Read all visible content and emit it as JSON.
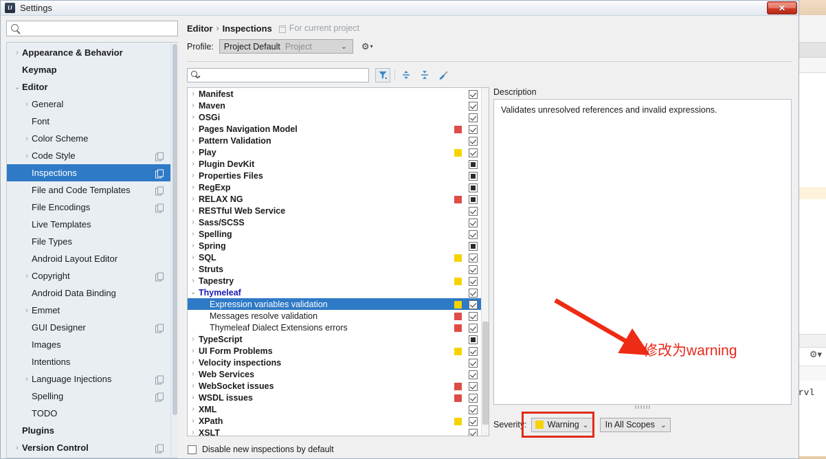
{
  "window": {
    "title": "Settings",
    "icon": "intellij-logo-icon",
    "close_label": "✕"
  },
  "sidebar": {
    "search_placeholder": "",
    "search_value": "",
    "items": [
      {
        "label": "Appearance & Behavior",
        "arrow": "›",
        "bold": true,
        "indent": 0,
        "copy": false,
        "selected": false
      },
      {
        "label": "Keymap",
        "arrow": "",
        "bold": true,
        "indent": 0,
        "copy": false,
        "selected": false
      },
      {
        "label": "Editor",
        "arrow": "⌄",
        "bold": true,
        "indent": 0,
        "copy": false,
        "selected": false
      },
      {
        "label": "General",
        "arrow": "›",
        "bold": false,
        "indent": 1,
        "copy": false,
        "selected": false
      },
      {
        "label": "Font",
        "arrow": "",
        "bold": false,
        "indent": 1,
        "copy": false,
        "selected": false
      },
      {
        "label": "Color Scheme",
        "arrow": "›",
        "bold": false,
        "indent": 1,
        "copy": false,
        "selected": false
      },
      {
        "label": "Code Style",
        "arrow": "›",
        "bold": false,
        "indent": 1,
        "copy": true,
        "selected": false
      },
      {
        "label": "Inspections",
        "arrow": "",
        "bold": false,
        "indent": 1,
        "copy": true,
        "selected": true
      },
      {
        "label": "File and Code Templates",
        "arrow": "",
        "bold": false,
        "indent": 1,
        "copy": true,
        "selected": false
      },
      {
        "label": "File Encodings",
        "arrow": "",
        "bold": false,
        "indent": 1,
        "copy": true,
        "selected": false
      },
      {
        "label": "Live Templates",
        "arrow": "",
        "bold": false,
        "indent": 1,
        "copy": false,
        "selected": false
      },
      {
        "label": "File Types",
        "arrow": "",
        "bold": false,
        "indent": 1,
        "copy": false,
        "selected": false
      },
      {
        "label": "Android Layout Editor",
        "arrow": "",
        "bold": false,
        "indent": 1,
        "copy": false,
        "selected": false
      },
      {
        "label": "Copyright",
        "arrow": "›",
        "bold": false,
        "indent": 1,
        "copy": true,
        "selected": false
      },
      {
        "label": "Android Data Binding",
        "arrow": "",
        "bold": false,
        "indent": 1,
        "copy": false,
        "selected": false
      },
      {
        "label": "Emmet",
        "arrow": "›",
        "bold": false,
        "indent": 1,
        "copy": false,
        "selected": false
      },
      {
        "label": "GUI Designer",
        "arrow": "",
        "bold": false,
        "indent": 1,
        "copy": true,
        "selected": false
      },
      {
        "label": "Images",
        "arrow": "",
        "bold": false,
        "indent": 1,
        "copy": false,
        "selected": false
      },
      {
        "label": "Intentions",
        "arrow": "",
        "bold": false,
        "indent": 1,
        "copy": false,
        "selected": false
      },
      {
        "label": "Language Injections",
        "arrow": "›",
        "bold": false,
        "indent": 1,
        "copy": true,
        "selected": false
      },
      {
        "label": "Spelling",
        "arrow": "",
        "bold": false,
        "indent": 1,
        "copy": true,
        "selected": false
      },
      {
        "label": "TODO",
        "arrow": "",
        "bold": false,
        "indent": 1,
        "copy": false,
        "selected": false
      },
      {
        "label": "Plugins",
        "arrow": "",
        "bold": true,
        "indent": 0,
        "copy": false,
        "selected": false
      },
      {
        "label": "Version Control",
        "arrow": "›",
        "bold": true,
        "indent": 0,
        "copy": true,
        "selected": false
      }
    ]
  },
  "header": {
    "breadcrumb_parent": "Editor",
    "breadcrumb_sep": "›",
    "breadcrumb_current": "Inspections",
    "scope_note": "For current project",
    "scope_note_icon": "project-scope-icon"
  },
  "profile": {
    "label": "Profile:",
    "value": "Project Default",
    "hint": "Project",
    "chevron": "⌄",
    "gear_icon": "gear-icon",
    "gear_caret": "▾"
  },
  "toolbar": {
    "search_value": "",
    "search_placeholder": "",
    "search_caret": "▾",
    "filter_icon": "filter-funnel-icon",
    "expand_icon": "expand-all-icon",
    "collapse_icon": "collapse-all-icon",
    "reset_icon": "reset-broom-icon"
  },
  "inspections": {
    "rows": [
      {
        "label": "Manifest",
        "arrow": "›",
        "severity": "",
        "check": "checked",
        "type": "group",
        "selected": false
      },
      {
        "label": "Maven",
        "arrow": "›",
        "severity": "",
        "check": "checked",
        "type": "group",
        "selected": false
      },
      {
        "label": "OSGi",
        "arrow": "›",
        "severity": "",
        "check": "checked",
        "type": "group",
        "selected": false
      },
      {
        "label": "Pages Navigation Model",
        "arrow": "›",
        "severity": "red",
        "check": "checked",
        "type": "group",
        "selected": false
      },
      {
        "label": "Pattern Validation",
        "arrow": "›",
        "severity": "",
        "check": "checked",
        "type": "group",
        "selected": false
      },
      {
        "label": "Play",
        "arrow": "›",
        "severity": "yellow",
        "check": "checked",
        "type": "group",
        "selected": false
      },
      {
        "label": "Plugin DevKit",
        "arrow": "›",
        "severity": "",
        "check": "partial",
        "type": "group",
        "selected": false
      },
      {
        "label": "Properties Files",
        "arrow": "›",
        "severity": "",
        "check": "partial",
        "type": "group",
        "selected": false
      },
      {
        "label": "RegExp",
        "arrow": "›",
        "severity": "",
        "check": "partial",
        "type": "group",
        "selected": false
      },
      {
        "label": "RELAX NG",
        "arrow": "›",
        "severity": "red",
        "check": "partial",
        "type": "group",
        "selected": false
      },
      {
        "label": "RESTful Web Service",
        "arrow": "›",
        "severity": "",
        "check": "checked",
        "type": "group",
        "selected": false
      },
      {
        "label": "Sass/SCSS",
        "arrow": "›",
        "severity": "",
        "check": "checked",
        "type": "group",
        "selected": false
      },
      {
        "label": "Spelling",
        "arrow": "›",
        "severity": "",
        "check": "checked",
        "type": "group",
        "selected": false
      },
      {
        "label": "Spring",
        "arrow": "›",
        "severity": "",
        "check": "partial",
        "type": "group",
        "selected": false
      },
      {
        "label": "SQL",
        "arrow": "›",
        "severity": "yellow",
        "check": "checked",
        "type": "group",
        "selected": false
      },
      {
        "label": "Struts",
        "arrow": "›",
        "severity": "",
        "check": "checked",
        "type": "group",
        "selected": false
      },
      {
        "label": "Tapestry",
        "arrow": "›",
        "severity": "yellow",
        "check": "checked",
        "type": "group",
        "selected": false
      },
      {
        "label": "Thymeleaf",
        "arrow": "⌄",
        "severity": "",
        "check": "checked",
        "type": "group-open",
        "selected": false
      },
      {
        "label": "Expression variables validation",
        "arrow": "",
        "severity": "yellow",
        "check": "checked",
        "type": "child",
        "selected": true
      },
      {
        "label": "Messages resolve validation",
        "arrow": "",
        "severity": "red",
        "check": "checked",
        "type": "child",
        "selected": false
      },
      {
        "label": "Thymeleaf Dialect Extensions errors",
        "arrow": "",
        "severity": "red",
        "check": "checked",
        "type": "child",
        "selected": false
      },
      {
        "label": "TypeScript",
        "arrow": "›",
        "severity": "",
        "check": "partial",
        "type": "group",
        "selected": false
      },
      {
        "label": "UI Form Problems",
        "arrow": "›",
        "severity": "yellow",
        "check": "checked",
        "type": "group",
        "selected": false
      },
      {
        "label": "Velocity inspections",
        "arrow": "›",
        "severity": "",
        "check": "checked",
        "type": "group",
        "selected": false
      },
      {
        "label": "Web Services",
        "arrow": "›",
        "severity": "",
        "check": "checked",
        "type": "group",
        "selected": false
      },
      {
        "label": "WebSocket issues",
        "arrow": "›",
        "severity": "red",
        "check": "checked",
        "type": "group",
        "selected": false
      },
      {
        "label": "WSDL issues",
        "arrow": "›",
        "severity": "red",
        "check": "checked",
        "type": "group",
        "selected": false
      },
      {
        "label": "XML",
        "arrow": "›",
        "severity": "",
        "check": "checked",
        "type": "group",
        "selected": false
      },
      {
        "label": "XPath",
        "arrow": "›",
        "severity": "yellow",
        "check": "checked",
        "type": "group",
        "selected": false
      },
      {
        "label": "XSLT",
        "arrow": "›",
        "severity": "",
        "check": "checked",
        "type": "group",
        "selected": false
      }
    ]
  },
  "description": {
    "title": "Description",
    "text": "Validates unresolved references and invalid expressions."
  },
  "severity": {
    "label": "Severity:",
    "value": "Warning",
    "color": "#f5d300",
    "chevron": "⌄",
    "scope_value": "In All Scopes",
    "scope_chevron": "⌄"
  },
  "footer": {
    "disable_label": "Disable new inspections by default",
    "disable_checked": false
  },
  "annotation": {
    "text": "修改为warning",
    "color": "#e8291a",
    "arrow_icon": "red-arrow-icon",
    "highlight_box_color": "#e02b18"
  },
  "background": {
    "blurred_text": "█░█░ █░█ ░██░█ ░█░█░",
    "editor_fragment": "ervl",
    "gear_icon": "gear-icon"
  }
}
